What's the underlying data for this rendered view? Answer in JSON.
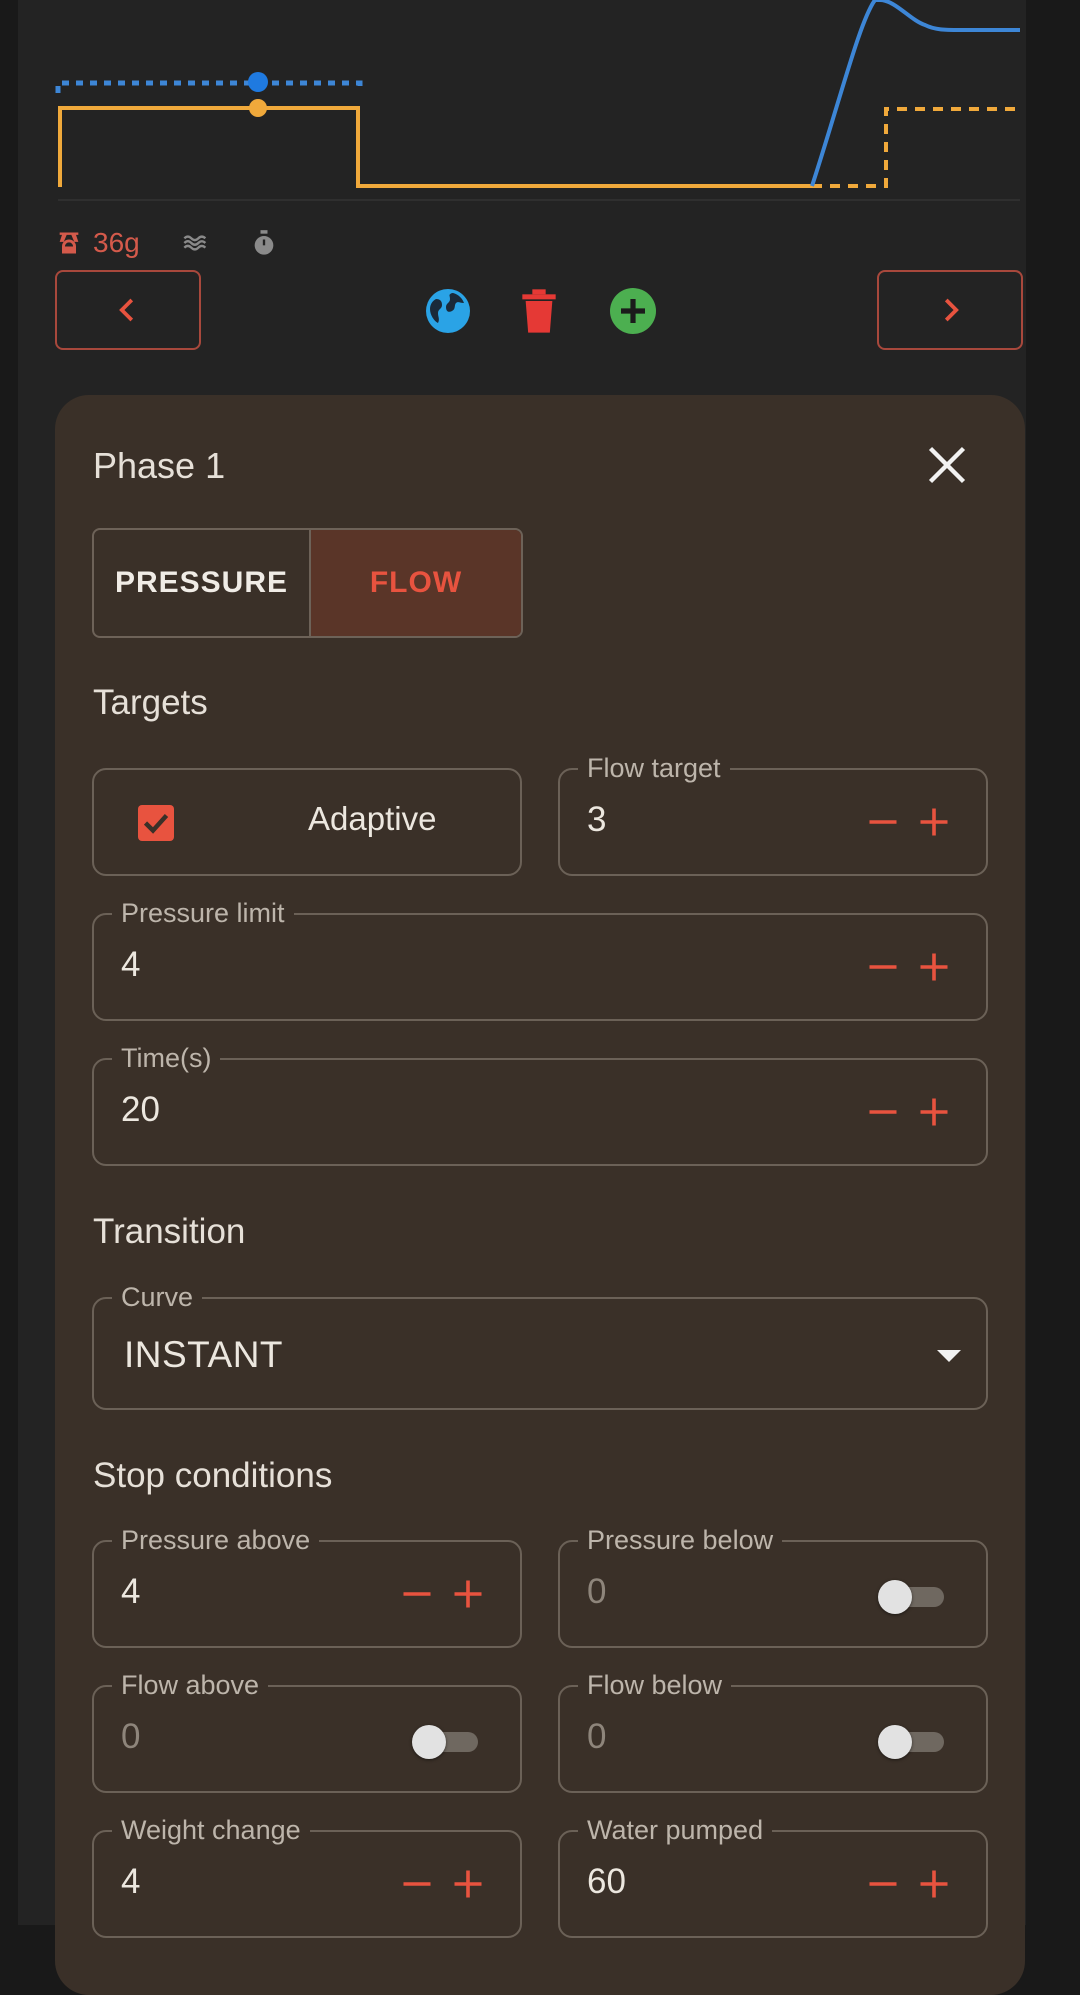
{
  "colors": {
    "accent": "#e8533f",
    "pressure_line": "#3d86d6",
    "flow_line": "#f0a93b",
    "add": "#4caf50",
    "globe": "#2aa3e6",
    "delete": "#e53935"
  },
  "stats": {
    "weight": "36g",
    "icons": [
      "scale-icon",
      "water-waves-icon",
      "stopwatch-icon"
    ]
  },
  "actions": {
    "prev_icon": "chevron-left-icon",
    "next_icon": "chevron-right-icon",
    "globe_icon": "globe-icon",
    "delete_icon": "trash-icon",
    "add_icon": "add-circle-icon"
  },
  "phase": {
    "title": "Phase 1",
    "type_options": [
      "PRESSURE",
      "FLOW"
    ],
    "selected_type": "FLOW",
    "targets_heading": "Targets",
    "adaptive_label": "Adaptive",
    "adaptive_checked": true,
    "flow_target": {
      "label": "Flow target",
      "value": "3"
    },
    "pressure_limit": {
      "label": "Pressure limit",
      "value": "4"
    },
    "time": {
      "label": "Time(s)",
      "value": "20"
    },
    "transition_heading": "Transition",
    "curve": {
      "label": "Curve",
      "value": "INSTANT"
    },
    "stop_heading": "Stop conditions",
    "stop_conditions": {
      "pressure_above": {
        "label": "Pressure above",
        "value": "4",
        "enabled": true
      },
      "pressure_below": {
        "label": "Pressure below",
        "value": "0",
        "enabled": false
      },
      "flow_above": {
        "label": "Flow above",
        "value": "0",
        "enabled": false
      },
      "flow_below": {
        "label": "Flow below",
        "value": "0",
        "enabled": false
      },
      "weight_change": {
        "label": "Weight change",
        "value": "4",
        "enabled": true
      },
      "water_pumped": {
        "label": "Water pumped",
        "value": "60",
        "enabled": true
      }
    }
  }
}
